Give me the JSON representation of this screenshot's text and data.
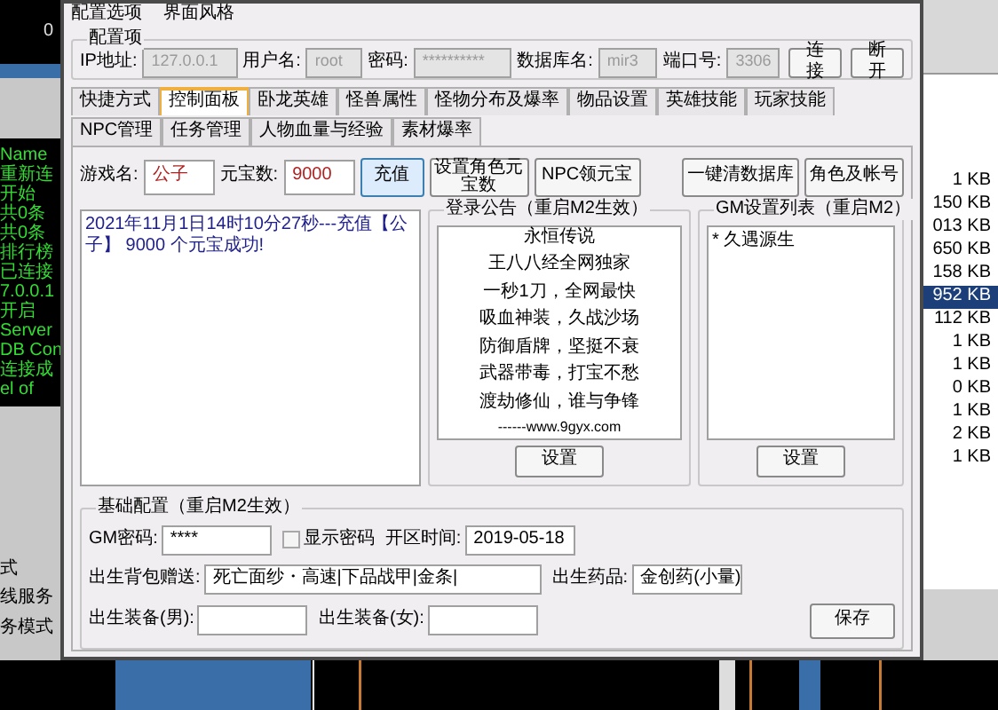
{
  "background": {
    "counter": "0",
    "console_lines": [
      "Name",
      "重新连",
      "开始",
      "共0条",
      "共0条",
      "排行榜",
      "已连接",
      "7.0.0.1",
      "开启",
      "Server",
      "DB Con",
      "连接成",
      "el of"
    ],
    "side_labels": [
      "式",
      "线服务",
      "务模式"
    ],
    "file_sizes": [
      {
        "text": "1 KB",
        "selected": false
      },
      {
        "text": "150 KB",
        "selected": false
      },
      {
        "text": "013 KB",
        "selected": false
      },
      {
        "text": "650 KB",
        "selected": false
      },
      {
        "text": "158 KB",
        "selected": false
      },
      {
        "text": "952 KB",
        "selected": true
      },
      {
        "text": "112 KB",
        "selected": false
      },
      {
        "text": "1 KB",
        "selected": false
      },
      {
        "text": "1 KB",
        "selected": false
      },
      {
        "text": "0 KB",
        "selected": false
      },
      {
        "text": "1 KB",
        "selected": false
      },
      {
        "text": "2 KB",
        "selected": false
      },
      {
        "text": "1 KB",
        "selected": false
      }
    ]
  },
  "window": {
    "menu": [
      "配置选项",
      "界面风格"
    ],
    "connection": {
      "title": "配置项",
      "fields": [
        {
          "label": "IP地址:",
          "value": "127.0.0.1",
          "disabled": true
        },
        {
          "label": "用户名:",
          "value": "root",
          "disabled": true
        },
        {
          "label": "密码:",
          "value": "**********",
          "disabled": true
        },
        {
          "label": "数据库名:",
          "value": "mir3",
          "disabled": true
        },
        {
          "label": "端口号:",
          "value": "3306",
          "disabled": true
        }
      ],
      "buttons": [
        "连接",
        "断开"
      ]
    },
    "tabs": [
      {
        "label": "快捷方式",
        "selected": false
      },
      {
        "label": "控制面板",
        "selected": true
      },
      {
        "label": "卧龙英雄",
        "selected": false
      },
      {
        "label": "怪兽属性",
        "selected": false
      },
      {
        "label": "怪物分布及爆率",
        "selected": false
      },
      {
        "label": "物品设置",
        "selected": false
      },
      {
        "label": "英雄技能",
        "selected": false
      },
      {
        "label": "玩家技能",
        "selected": false
      },
      {
        "label": "NPC管理",
        "selected": false
      },
      {
        "label": "任务管理",
        "selected": false
      },
      {
        "label": "人物血量与经验",
        "selected": false
      },
      {
        "label": "素材爆率",
        "selected": false
      }
    ],
    "control_panel": {
      "fields": [
        {
          "label": "游戏名:",
          "value": "公子"
        },
        {
          "label": "元宝数:",
          "value": "9000"
        }
      ],
      "buttons": [
        {
          "label": "充值",
          "focused": true
        },
        {
          "label": "设置角色元宝数",
          "focused": false
        },
        {
          "label": "NPC领元宝",
          "focused": false
        },
        {
          "label": "一键清数据库",
          "focused": false
        },
        {
          "label": "角色及帐号",
          "focused": false
        }
      ],
      "log": [
        "2021年11月1日14时10分27秒---充值【公子】 9000 个元宝成功!"
      ],
      "announcement": {
        "title": "登录公告（重启M2生效）",
        "lines": [
          "永恒传说",
          "王八八经全网独家",
          "一秒1刀，全网最快",
          "吸血神装，久战沙场",
          "防御盾牌，坚挺不衰",
          "武器带毒，打宝不愁",
          "渡劫修仙，谁与争锋",
          "------www.9gyx.com"
        ],
        "button": "设置"
      },
      "gm_list": {
        "title": "GM设置列表（重启M2）",
        "items": [
          "* 久遇源生"
        ],
        "button": "设置"
      },
      "base_config": {
        "title": "基础配置（重启M2生效）",
        "items": [
          {
            "kind": "field",
            "label": "GM密码:",
            "value": "****"
          },
          {
            "kind": "checkbox",
            "label": "显示密码",
            "checked": false
          },
          {
            "kind": "field",
            "label": "开区时间:",
            "value": "2019-05-18"
          },
          {
            "kind": "field",
            "label": "出生背包赠送:",
            "value": "死亡面纱・高速|下品战甲|金条|"
          },
          {
            "kind": "field",
            "label": "出生药品:",
            "value": "金创药(小量)"
          },
          {
            "kind": "field",
            "label": "出生装备(男):"
          },
          {
            "kind": "field",
            "label": "出生装备(女):"
          }
        ],
        "save": "保存"
      }
    }
  }
}
